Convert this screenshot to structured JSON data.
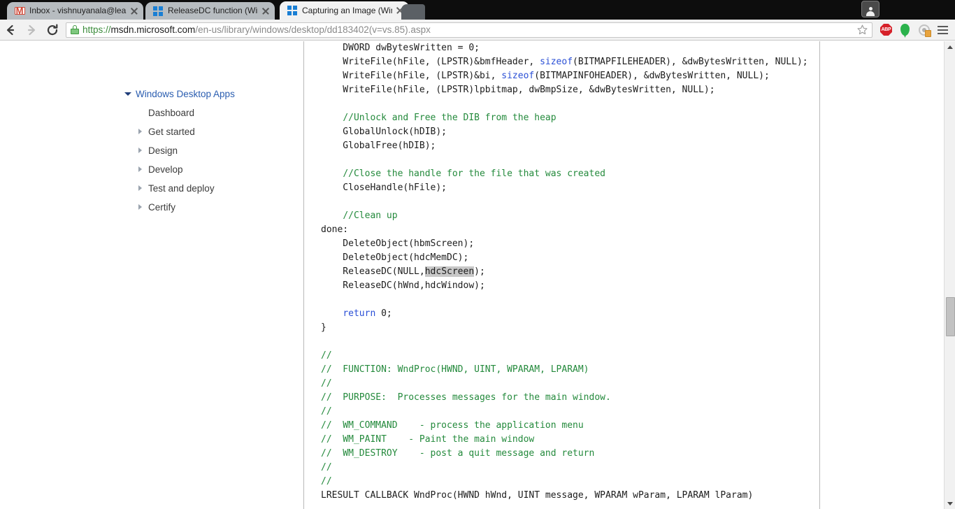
{
  "browser": {
    "tabs": [
      {
        "title": "Inbox - vishnuyanala@lea",
        "favicon": "gmail-icon",
        "active": false
      },
      {
        "title": "ReleaseDC function (Wind",
        "favicon": "windows-icon",
        "active": false
      },
      {
        "title": "Capturing an Image (Winc",
        "favicon": "windows-icon",
        "active": true
      }
    ],
    "nav": {
      "back_label": "Back",
      "forward_label": "Forward",
      "reload_label": "Reload"
    },
    "omnibox": {
      "scheme": "https://",
      "host": "msdn.microsoft.com",
      "path": "/en-us/library/windows/desktop/dd183402(v=vs.85).aspx",
      "security_icon": "lock-icon",
      "bookmark_icon": "star-icon"
    },
    "extensions": [
      {
        "name": "abp-icon",
        "label": "ABP"
      },
      {
        "name": "pin-icon",
        "label": ""
      },
      {
        "name": "disc-icon",
        "label": ""
      }
    ],
    "menu_icon": "hamburger-icon",
    "profile_icon": "avatar-icon"
  },
  "sidebar": {
    "items": [
      {
        "label": "Windows Desktop Apps",
        "level": 1,
        "arrow": "down",
        "style": "root"
      },
      {
        "label": "Dashboard",
        "level": 2,
        "arrow": "none",
        "style": "sub"
      },
      {
        "label": "Get started",
        "level": 2,
        "arrow": "right",
        "style": "sub"
      },
      {
        "label": "Design",
        "level": 2,
        "arrow": "right",
        "style": "sub"
      },
      {
        "label": "Develop",
        "level": 2,
        "arrow": "right",
        "style": "sub"
      },
      {
        "label": "Test and deploy",
        "level": 2,
        "arrow": "right",
        "style": "sub"
      },
      {
        "label": "Certify",
        "level": 2,
        "arrow": "right",
        "style": "sub"
      }
    ]
  },
  "code": {
    "selected_text": "hdcScreen",
    "lines": [
      [
        {
          "t": "    DWORD dwBytesWritten = 0;",
          "c": ""
        }
      ],
      [
        {
          "t": "    WriteFile(hFile, (LPSTR)&bmfHeader, ",
          "c": ""
        },
        {
          "t": "sizeof",
          "c": "kw"
        },
        {
          "t": "(BITMAPFILEHEADER), &dwBytesWritten, NULL);",
          "c": ""
        }
      ],
      [
        {
          "t": "    WriteFile(hFile, (LPSTR)&bi, ",
          "c": ""
        },
        {
          "t": "sizeof",
          "c": "kw"
        },
        {
          "t": "(BITMAPINFOHEADER), &dwBytesWritten, NULL);",
          "c": ""
        }
      ],
      [
        {
          "t": "    WriteFile(hFile, (LPSTR)lpbitmap, dwBmpSize, &dwBytesWritten, NULL);",
          "c": ""
        }
      ],
      [
        {
          "t": "",
          "c": ""
        }
      ],
      [
        {
          "t": "    ",
          "c": ""
        },
        {
          "t": "//Unlock and Free the DIB from the heap",
          "c": "cm"
        }
      ],
      [
        {
          "t": "    GlobalUnlock(hDIB);",
          "c": ""
        }
      ],
      [
        {
          "t": "    GlobalFree(hDIB);",
          "c": ""
        }
      ],
      [
        {
          "t": "",
          "c": ""
        }
      ],
      [
        {
          "t": "    ",
          "c": ""
        },
        {
          "t": "//Close the handle for the file that was created",
          "c": "cm"
        }
      ],
      [
        {
          "t": "    CloseHandle(hFile);",
          "c": ""
        }
      ],
      [
        {
          "t": "",
          "c": ""
        }
      ],
      [
        {
          "t": "    ",
          "c": ""
        },
        {
          "t": "//Clean up",
          "c": "cm"
        }
      ],
      [
        {
          "t": "done:",
          "c": ""
        }
      ],
      [
        {
          "t": "    DeleteObject(hbmScreen);",
          "c": ""
        }
      ],
      [
        {
          "t": "    DeleteObject(hdcMemDC);",
          "c": ""
        }
      ],
      [
        {
          "t": "    ReleaseDC(NULL,",
          "c": ""
        },
        {
          "t": "hdcScreen",
          "c": "hl"
        },
        {
          "t": ");",
          "c": ""
        }
      ],
      [
        {
          "t": "    ReleaseDC(hWnd,hdcWindow);",
          "c": ""
        }
      ],
      [
        {
          "t": "",
          "c": ""
        }
      ],
      [
        {
          "t": "    ",
          "c": ""
        },
        {
          "t": "return",
          "c": "kw"
        },
        {
          "t": " 0;",
          "c": ""
        }
      ],
      [
        {
          "t": "}",
          "c": ""
        }
      ],
      [
        {
          "t": "",
          "c": ""
        }
      ],
      [
        {
          "t": "//",
          "c": "cm"
        }
      ],
      [
        {
          "t": "//  FUNCTION: WndProc(HWND, UINT, WPARAM, LPARAM)",
          "c": "cm"
        }
      ],
      [
        {
          "t": "//",
          "c": "cm"
        }
      ],
      [
        {
          "t": "//  PURPOSE:  Processes messages for the main window.",
          "c": "cm"
        }
      ],
      [
        {
          "t": "//",
          "c": "cm"
        }
      ],
      [
        {
          "t": "//  WM_COMMAND    - process the application menu",
          "c": "cm"
        }
      ],
      [
        {
          "t": "//  WM_PAINT    - Paint the main window",
          "c": "cm"
        }
      ],
      [
        {
          "t": "//  WM_DESTROY    - post a quit message and return",
          "c": "cm"
        }
      ],
      [
        {
          "t": "//",
          "c": "cm"
        }
      ],
      [
        {
          "t": "//",
          "c": "cm"
        }
      ],
      [
        {
          "t": "LRESULT CALLBACK WndProc(HWND hWnd, UINT message, WPARAM wParam, LPARAM lParam)",
          "c": ""
        }
      ]
    ]
  },
  "scrollbar": {
    "up_icon": "scroll-up-arrow-icon",
    "down_icon": "scroll-down-arrow-icon"
  },
  "colors": {
    "link": "#2a5db0",
    "comment": "#248a3c",
    "keyword": "#2a4fd6",
    "selection": "#c8c8c8",
    "https_green": "#3c8c3c",
    "abp_red": "#d6212a",
    "pin_green": "#2bb24c"
  }
}
